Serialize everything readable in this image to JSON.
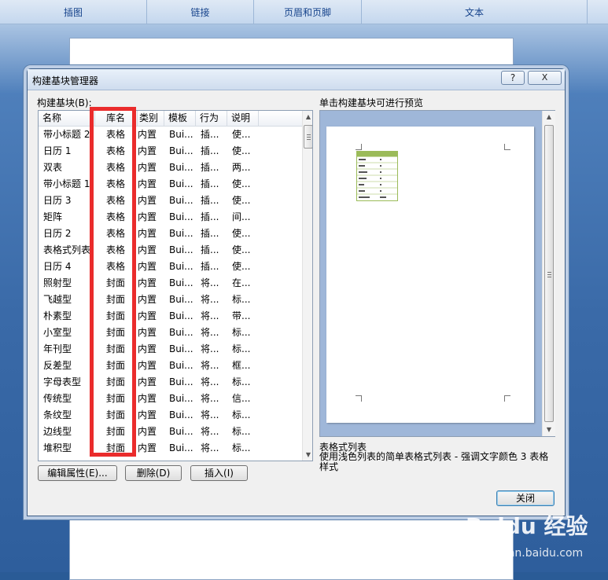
{
  "ribbon": {
    "groups": [
      "插图",
      "链接",
      "页眉和页脚",
      "文本"
    ]
  },
  "dialog": {
    "title": "构建基块管理器",
    "help_label": "?",
    "close_label": "X",
    "list_label": "构建基块(B):",
    "preview_label": "单击构建基块可进行预览",
    "columns": [
      "名称",
      "库名",
      "类别",
      "模板",
      "行为",
      "说明"
    ],
    "rows": [
      [
        "带小标题 2",
        "表格",
        "内置",
        "Bui...",
        "插...",
        "使..."
      ],
      [
        "日历 1",
        "表格",
        "内置",
        "Bui...",
        "插...",
        "使..."
      ],
      [
        "双表",
        "表格",
        "内置",
        "Bui...",
        "插...",
        "两..."
      ],
      [
        "带小标题 1",
        "表格",
        "内置",
        "Bui...",
        "插...",
        "使..."
      ],
      [
        "日历 3",
        "表格",
        "内置",
        "Bui...",
        "插...",
        "使..."
      ],
      [
        "矩阵",
        "表格",
        "内置",
        "Bui...",
        "插...",
        "间..."
      ],
      [
        "日历 2",
        "表格",
        "内置",
        "Bui...",
        "插...",
        "使..."
      ],
      [
        "表格式列表",
        "表格",
        "内置",
        "Bui...",
        "插...",
        "使..."
      ],
      [
        "日历 4",
        "表格",
        "内置",
        "Bui...",
        "插...",
        "使..."
      ],
      [
        "照射型",
        "封面",
        "内置",
        "Bui...",
        "将...",
        "在..."
      ],
      [
        "飞越型",
        "封面",
        "内置",
        "Bui...",
        "将...",
        "标..."
      ],
      [
        "朴素型",
        "封面",
        "内置",
        "Bui...",
        "将...",
        "带..."
      ],
      [
        "小室型",
        "封面",
        "内置",
        "Bui...",
        "将...",
        "标..."
      ],
      [
        "年刊型",
        "封面",
        "内置",
        "Bui...",
        "将...",
        "标..."
      ],
      [
        "反差型",
        "封面",
        "内置",
        "Bui...",
        "将...",
        "框..."
      ],
      [
        "字母表型",
        "封面",
        "内置",
        "Bui...",
        "将...",
        "标..."
      ],
      [
        "传统型",
        "封面",
        "内置",
        "Bui...",
        "将...",
        "信..."
      ],
      [
        "条纹型",
        "封面",
        "内置",
        "Bui...",
        "将...",
        "标..."
      ],
      [
        "边线型",
        "封面",
        "内置",
        "Bui...",
        "将...",
        "标..."
      ],
      [
        "堆积型",
        "封面",
        "内置",
        "Bui...",
        "将...",
        "标..."
      ]
    ],
    "preview_name": "表格式列表",
    "preview_desc": "使用浅色列表的简单表格式列表 - 强调文字颜色 3 表格样式",
    "buttons": {
      "edit": "编辑属性(E)...",
      "delete": "删除(D)",
      "insert": "插入(I)",
      "close": "关闭"
    }
  },
  "watermark": {
    "main": "Baidu 经验",
    "sub": "jingyan.baidu.com"
  },
  "colors": {
    "highlight": "#ea2c2c",
    "accent": "#15428b"
  }
}
